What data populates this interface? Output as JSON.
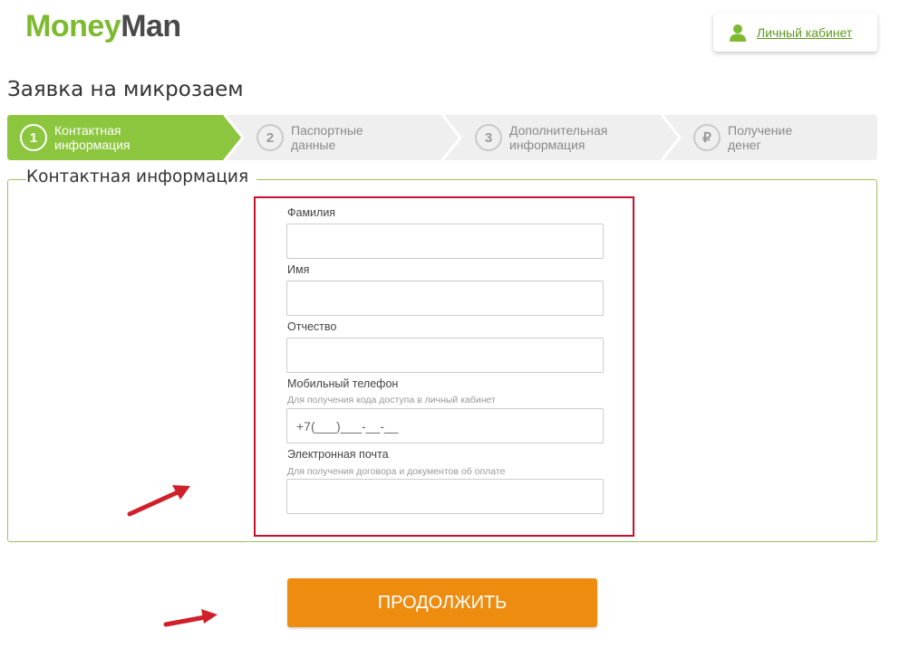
{
  "brand": {
    "logo_part1": "Money",
    "logo_part2": "Man"
  },
  "header": {
    "account_link": "Личный кабинет"
  },
  "page": {
    "title": "Заявка на микрозаем"
  },
  "steps": [
    {
      "number": "1",
      "label": "Контактная\nинформация",
      "active": true
    },
    {
      "number": "2",
      "label": "Паспортные\nданные",
      "active": false
    },
    {
      "number": "3",
      "label": "Дополнительная\nинформация",
      "active": false
    },
    {
      "number": "₽",
      "label": "Получение\nденег",
      "active": false
    }
  ],
  "form": {
    "legend": "Контактная информация",
    "fields": {
      "last_name": {
        "label": "Фамилия",
        "value": ""
      },
      "first_name": {
        "label": "Имя",
        "value": ""
      },
      "middle_name": {
        "label": "Отчество",
        "value": ""
      },
      "phone": {
        "label": "Мобильный телефон",
        "hint": "Для получения кода доступа в личный кабинет",
        "placeholder": "+7(___)___-__-__"
      },
      "email": {
        "label": "Электронная почта",
        "hint": "Для получения договора и документов об оплате",
        "value": ""
      }
    },
    "submit_label": "ПРОДОЛЖИТЬ"
  },
  "colors": {
    "brand_green": "#7dba2f",
    "button_orange": "#ee8c10",
    "highlight_red": "#c8102e",
    "arrow_red": "#d0202a"
  }
}
